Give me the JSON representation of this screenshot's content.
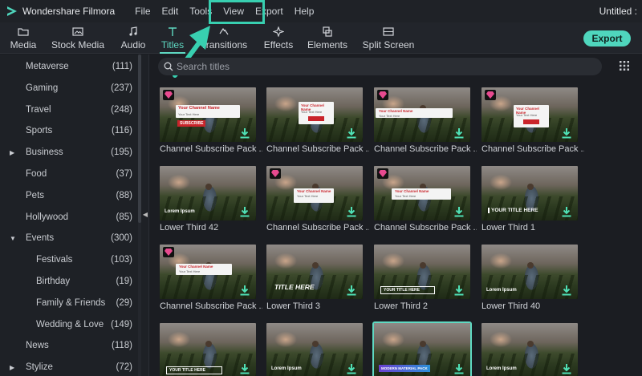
{
  "app": {
    "name": "Wondershare Filmora",
    "doc_title": "Untitled :"
  },
  "menu": [
    "File",
    "Edit",
    "Tools",
    "View",
    "Export",
    "Help"
  ],
  "toolbar": {
    "tabs": [
      {
        "label": "Media",
        "icon": "folder-icon"
      },
      {
        "label": "Stock Media",
        "icon": "image-folder-icon"
      },
      {
        "label": "Audio",
        "icon": "music-note-icon"
      },
      {
        "label": "Titles",
        "icon": "text-t-icon"
      },
      {
        "label": "Transitions",
        "icon": "transitions-icon"
      },
      {
        "label": "Effects",
        "icon": "sparkle-icon"
      },
      {
        "label": "Elements",
        "icon": "elements-icon"
      },
      {
        "label": "Split Screen",
        "icon": "split-screen-icon"
      }
    ],
    "active_tab": "Titles",
    "export_label": "Export"
  },
  "annotation": {
    "highlighted_menu": "Export",
    "accent": "#38cfb0"
  },
  "sidebar": {
    "categories": [
      {
        "name": "Metaverse",
        "count": "(111)",
        "level": 0,
        "caret": ""
      },
      {
        "name": "Gaming",
        "count": "(237)",
        "level": 0,
        "caret": ""
      },
      {
        "name": "Travel",
        "count": "(248)",
        "level": 0,
        "caret": ""
      },
      {
        "name": "Sports",
        "count": "(116)",
        "level": 0,
        "caret": ""
      },
      {
        "name": "Business",
        "count": "(195)",
        "level": 0,
        "caret": "collapsed"
      },
      {
        "name": "Food",
        "count": "(37)",
        "level": 0,
        "caret": ""
      },
      {
        "name": "Pets",
        "count": "(88)",
        "level": 0,
        "caret": ""
      },
      {
        "name": "Hollywood",
        "count": "(85)",
        "level": 0,
        "caret": ""
      },
      {
        "name": "Events",
        "count": "(300)",
        "level": 0,
        "caret": "expanded"
      },
      {
        "name": "Festivals",
        "count": "(103)",
        "level": 1,
        "caret": ""
      },
      {
        "name": "Birthday",
        "count": "(19)",
        "level": 1,
        "caret": ""
      },
      {
        "name": "Family & Friends",
        "count": "(29)",
        "level": 1,
        "caret": ""
      },
      {
        "name": "Wedding & Love",
        "count": "(149)",
        "level": 1,
        "caret": ""
      },
      {
        "name": "News",
        "count": "(118)",
        "level": 0,
        "caret": ""
      },
      {
        "name": "Stylize",
        "count": "(72)",
        "level": 0,
        "caret": "collapsed"
      }
    ]
  },
  "search": {
    "placeholder": "Search titles",
    "value": ""
  },
  "grid": {
    "items": [
      {
        "label": "Channel Subscribe Pack ...",
        "premium": true,
        "overlay": "sub-a",
        "overlay_text": [
          "Your Channel Name",
          "Your Text Here",
          "SUBSCRIBE"
        ]
      },
      {
        "label": "Channel Subscribe Pack ...",
        "premium": false,
        "overlay": "sub-b",
        "overlay_text": [
          "Your Channel Name",
          "Your Text Here"
        ]
      },
      {
        "label": "Channel Subscribe Pack ...",
        "premium": true,
        "overlay": "sub-c",
        "overlay_text": [
          "Your Channel Name",
          "Your Text Here"
        ]
      },
      {
        "label": "Channel Subscribe Pack ...",
        "premium": true,
        "overlay": "sub-d",
        "overlay_text": [
          "Your Channel Name",
          "Your Text Here"
        ]
      },
      {
        "label": "Lower Third 42",
        "premium": false,
        "overlay": "lt42",
        "overlay_text": [
          "Lorem Ipsum"
        ]
      },
      {
        "label": "Channel Subscribe Pack ...",
        "premium": true,
        "overlay": "sub-e",
        "overlay_text": [
          "Your Channel Name",
          "Your Text Here"
        ]
      },
      {
        "label": "Channel Subscribe Pack ...",
        "premium": true,
        "overlay": "sub-f",
        "overlay_text": [
          "Your Channel Name",
          "Your Text Here"
        ]
      },
      {
        "label": "Lower Third 1",
        "premium": false,
        "overlay": "lt1",
        "overlay_text": [
          "YOUR TITLE HERE"
        ]
      },
      {
        "label": "Channel Subscribe Pack ...",
        "premium": true,
        "overlay": "sub-g",
        "overlay_text": [
          "Your Channel Name",
          "Your Text Here"
        ]
      },
      {
        "label": "Lower Third 3",
        "premium": false,
        "overlay": "lt3",
        "overlay_text": [
          "TITLE HERE"
        ]
      },
      {
        "label": "Lower Third 2",
        "premium": false,
        "overlay": "lt2",
        "overlay_text": [
          "YOUR TITLE HERE"
        ]
      },
      {
        "label": "Lower Third 40",
        "premium": false,
        "overlay": "lt40",
        "overlay_text": [
          "Lorem Ipsum"
        ]
      },
      {
        "label": "",
        "premium": false,
        "overlay": "r4a",
        "overlay_text": [
          "YOUR TITLE HERE"
        ]
      },
      {
        "label": "",
        "premium": false,
        "overlay": "r4b",
        "overlay_text": [
          "Lorem Ipsum"
        ]
      },
      {
        "label": "",
        "premium": false,
        "overlay": "r4c",
        "overlay_text": [
          "MODERN MATERIAL PACK"
        ],
        "selected": true
      },
      {
        "label": "",
        "premium": false,
        "overlay": "r4d",
        "overlay_text": [
          "Lorem Ipsum"
        ]
      }
    ]
  }
}
